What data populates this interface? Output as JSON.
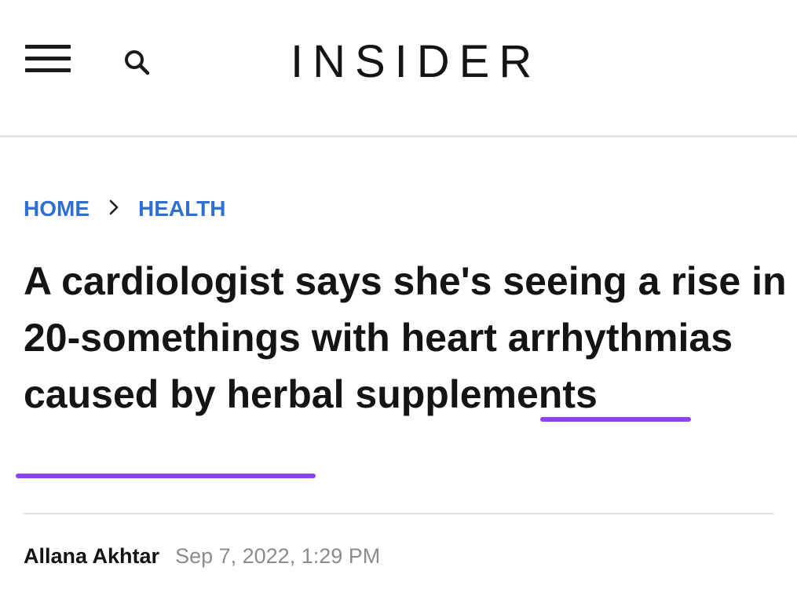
{
  "header": {
    "brand": "INSIDER",
    "menu_icon": "hamburger-menu-icon",
    "search_icon": "search-icon"
  },
  "breadcrumb": {
    "items": [
      {
        "label": "HOME"
      },
      {
        "label": "HEALTH"
      }
    ],
    "separator": ">",
    "separator_icon": "chevron-right-icon"
  },
  "article": {
    "headline": "A cardiologist says she's seeing a rise in 20-somethings with heart arrhythmias caused by herbal supplements",
    "author": "Allana Akhtar",
    "date": "Sep 7, 2022, 1:29 PM"
  },
  "colors": {
    "link_blue": "#2f6fcf",
    "underline_purple": "#8a45f0",
    "text": "#141414",
    "muted_text": "#8c8c8c",
    "divider": "#e4e4e4"
  }
}
